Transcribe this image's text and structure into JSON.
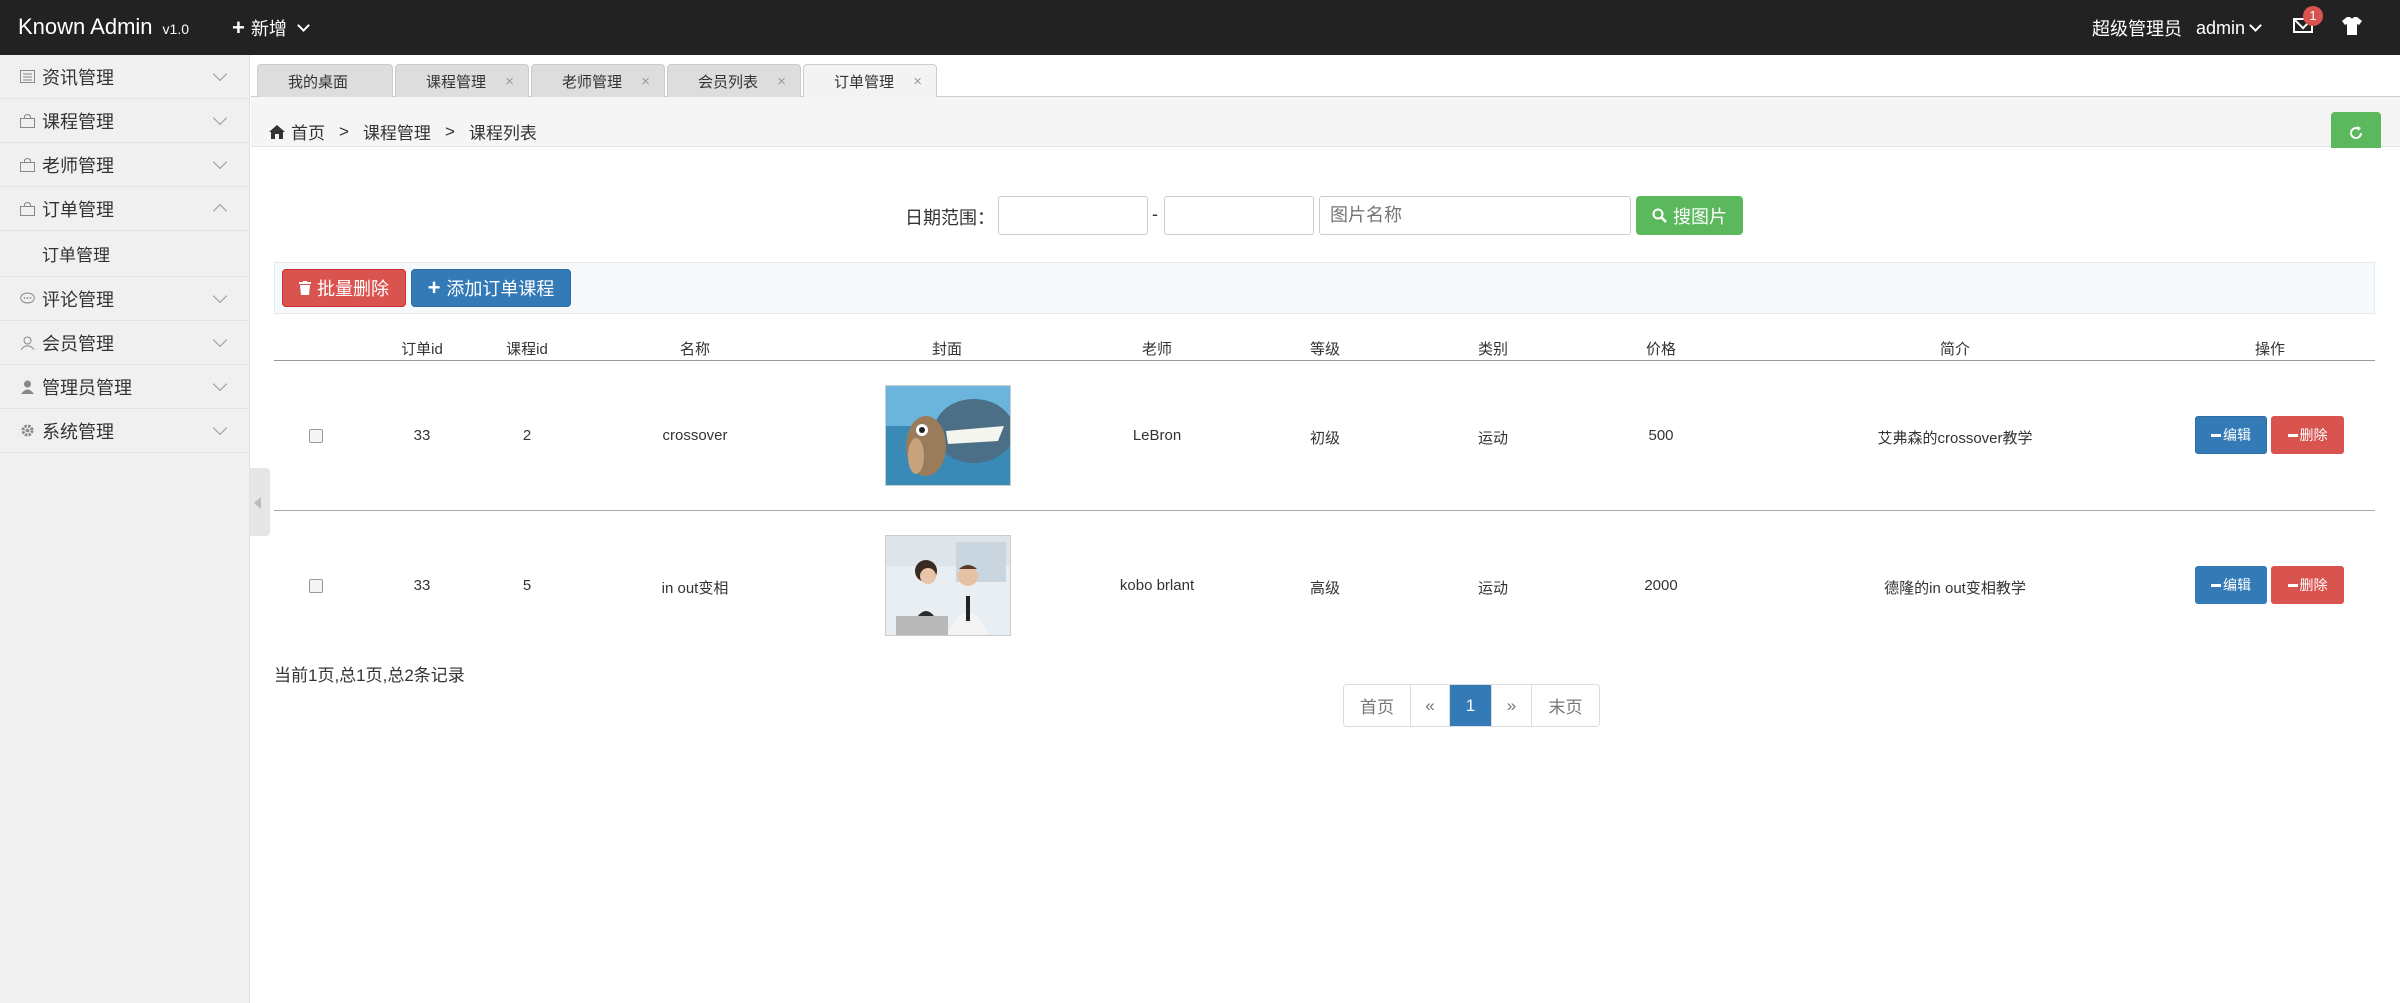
{
  "header": {
    "brand": "Known Admin",
    "version": "v1.0",
    "add_new": "新增",
    "role": "超级管理员",
    "username": "admin",
    "mail_badge": "1"
  },
  "sidebar": {
    "items": [
      {
        "label": "资讯管理",
        "icon": "newspaper-icon"
      },
      {
        "label": "课程管理",
        "icon": "bag-icon"
      },
      {
        "label": "老师管理",
        "icon": "bag-icon"
      },
      {
        "label": "订单管理",
        "icon": "bag-icon",
        "expanded": true,
        "children": [
          "订单管理"
        ]
      },
      {
        "label": "评论管理",
        "icon": "comment-icon"
      },
      {
        "label": "会员管理",
        "icon": "user-icon"
      },
      {
        "label": "管理员管理",
        "icon": "user-filled-icon"
      },
      {
        "label": "系统管理",
        "icon": "gear-icon"
      }
    ]
  },
  "tabs": [
    {
      "label": "我的桌面",
      "closable": false
    },
    {
      "label": "课程管理",
      "closable": true
    },
    {
      "label": "老师管理",
      "closable": true
    },
    {
      "label": "会员列表",
      "closable": true
    },
    {
      "label": "订单管理",
      "closable": true,
      "active": true
    }
  ],
  "breadcrumb": {
    "home": "首页",
    "level1": "课程管理",
    "level2": "课程列表",
    "sep": ">"
  },
  "search": {
    "date_label": "日期范围：",
    "date_from": "",
    "date_to": "",
    "dash": "-",
    "name_placeholder": "图片名称",
    "button": "搜图片"
  },
  "actions": {
    "batch_delete": "批量删除",
    "add_order_course": "添加订单课程"
  },
  "table": {
    "columns": [
      "订单id",
      "课程id",
      "名称",
      "封面",
      "老师",
      "等级",
      "类别",
      "价格",
      "简介",
      "操作"
    ],
    "rows": [
      {
        "order_id": "33",
        "course_id": "2",
        "name": "crossover",
        "cover": "cartoon-squirrel-dinosaur-image",
        "teacher": "LeBron",
        "level": "初级",
        "category": "运动",
        "price": "500",
        "intro": "艾弗森的crossover教学"
      },
      {
        "order_id": "33",
        "course_id": "5",
        "name": "in out变相",
        "cover": "office-people-image",
        "teacher": "kobo brlant",
        "level": "高级",
        "category": "运动",
        "price": "2000",
        "intro": "德隆的in out变相教学"
      }
    ],
    "edit_label": "编辑",
    "delete_label": "删除"
  },
  "pagination": {
    "info": "当前1页,总1页,总2条记录",
    "first": "首页",
    "prev": "«",
    "current": "1",
    "next": "»",
    "last": "末页"
  },
  "colors": {
    "topbar": "#222222",
    "success": "#5cb85c",
    "primary": "#337ab7",
    "danger": "#d9534f"
  }
}
